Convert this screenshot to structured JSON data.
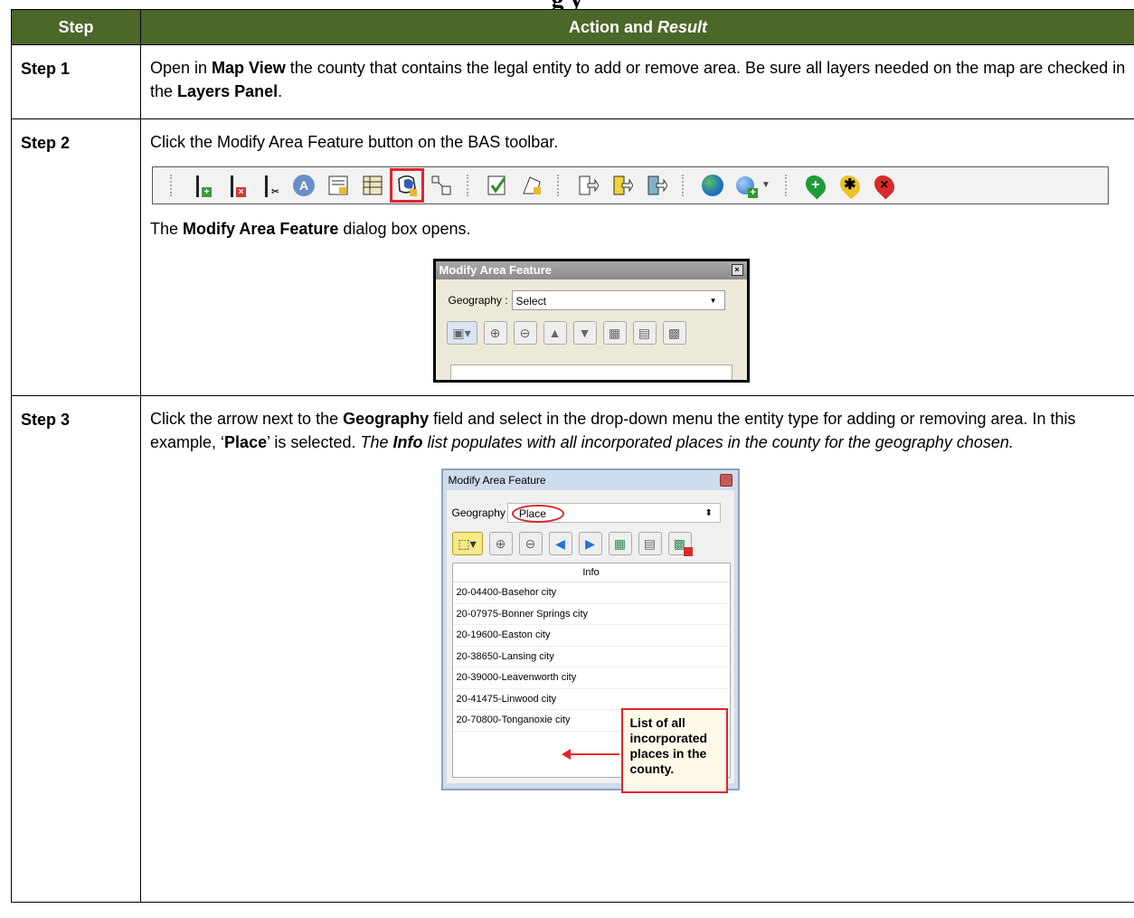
{
  "doc_title_partial": "g        y",
  "table": {
    "headers": {
      "step": "Step",
      "action_prefix": "Action and ",
      "action_italic": "Result"
    },
    "rows": [
      {
        "step": "Step 1",
        "t1": "Open in ",
        "b1": "Map View",
        "t2": " the county that contains the legal entity to add or remove area. Be sure all layers needed on the map are checked in the ",
        "b2": "Layers Panel",
        "t3": "."
      },
      {
        "step": "Step 2",
        "line1": "Click the Modify Area Feature button on the BAS toolbar.",
        "r1": "The ",
        "rb": "Modify Area Feature",
        "r2": " dialog box opens."
      },
      {
        "step": "Step 3",
        "t1": "Click the arrow next to the ",
        "b1": "Geography",
        "t2": " field and select in the drop-down menu the entity type for adding or removing area. In this example, ‘",
        "b2": "Place",
        "t3": "’ is selected. ",
        "i1": "The ",
        "ib": "Info",
        "i2": " list populates with all incorporated places in the county for the geography chosen."
      }
    ]
  },
  "dialog1": {
    "title": "Modify Area Feature",
    "geo_label": "Geography :",
    "geo_value": "Select"
  },
  "dialog2": {
    "title": "Modify Area Feature",
    "geo_label": "Geography",
    "geo_value": "Place",
    "list_header": "Info",
    "items": [
      "20-04400-Basehor city",
      "20-07975-Bonner Springs city",
      "20-19600-Easton city",
      "20-38650-Lansing city",
      "20-39000-Leavenworth city",
      "20-41475-Linwood city",
      "20-70800-Tonganoxie city"
    ],
    "callout": "List of all incorporated places in the county."
  },
  "icons": [
    "add-line-icon",
    "delete-line-icon",
    "split-line-icon",
    "search-feature-icon",
    "attribute-icon",
    "table-icon",
    "modify-area-icon",
    "topology-icon",
    "review-icon",
    "edit-polygon-icon",
    "export-icon",
    "export-highlight-icon",
    "export-alt-icon",
    "globe-icon",
    "add-globe-icon",
    "add-pin-icon",
    "star-pin-icon",
    "remove-pin-icon"
  ],
  "colors": {
    "header_bg": "#4c6729",
    "highlight": "#e0262b"
  }
}
